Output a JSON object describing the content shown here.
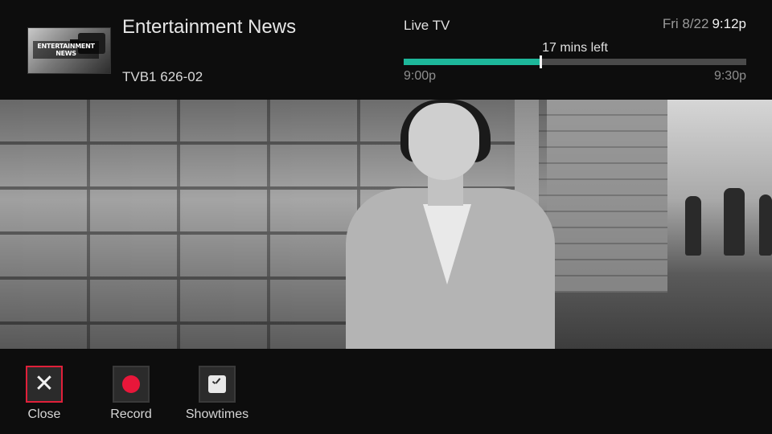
{
  "header": {
    "thumbnail_text": "ENTERTAINMENT NEWS",
    "show_title": "Entertainment News",
    "channel": "TVB1 626-02",
    "live_label": "Live TV",
    "date": "Fri 8/22",
    "time": "9:12p",
    "remaining": "17 mins left",
    "start_time": "9:00p",
    "end_time": "9:30p",
    "progress_fraction": 0.4,
    "accent_color": "#1db79a"
  },
  "actions": [
    {
      "label": "Close",
      "icon": "close-icon",
      "focused": true,
      "focus_color": "#e0203a"
    },
    {
      "label": "Record",
      "icon": "record-icon",
      "focused": false,
      "icon_color": "#e8173a"
    },
    {
      "label": "Showtimes",
      "icon": "clock-icon",
      "focused": false
    }
  ]
}
